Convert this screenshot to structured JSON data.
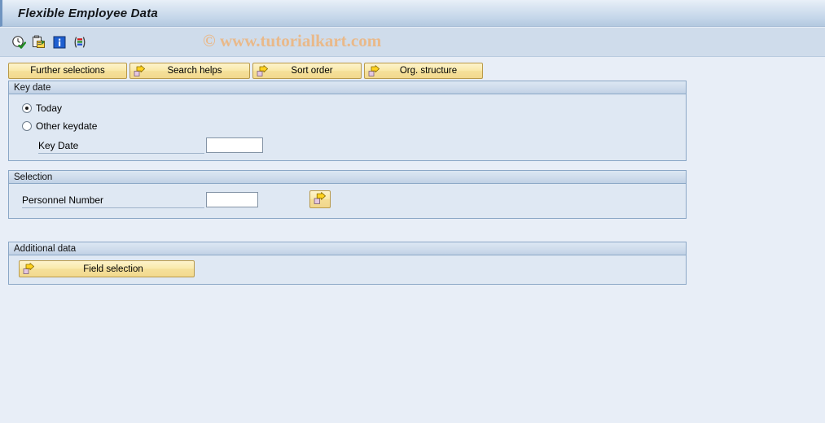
{
  "window": {
    "title": "Flexible Employee Data"
  },
  "toolbar": {
    "icons": [
      {
        "name": "execute-clock-icon",
        "title": "Execute"
      },
      {
        "name": "copy-variant-icon",
        "title": "Get Variant"
      },
      {
        "name": "info-icon",
        "title": "Information"
      },
      {
        "name": "stripes-selection-icon",
        "title": "Selection Options"
      }
    ]
  },
  "watermark": {
    "text": "© www.tutorialkart.com",
    "color": "#e9b98a"
  },
  "selection_buttons": [
    {
      "name": "further-selections-button",
      "label": "Further selections",
      "has_arrow_icon": false
    },
    {
      "name": "search-helps-button",
      "label": "Search helps",
      "has_arrow_icon": true
    },
    {
      "name": "sort-order-button",
      "label": "Sort order",
      "has_arrow_icon": true
    },
    {
      "name": "org-structure-button",
      "label": "Org. structure",
      "has_arrow_icon": true
    }
  ],
  "key_date_panel": {
    "header": "Key date",
    "radio_today": {
      "label": "Today",
      "checked": true
    },
    "radio_other": {
      "label": "Other keydate",
      "checked": false
    },
    "key_date_label": "Key Date",
    "key_date_value": "",
    "key_date_placeholder": ""
  },
  "selection_panel": {
    "header": "Selection",
    "personnel_number_label": "Personnel Number",
    "personnel_number_value": "",
    "personnel_number_placeholder": "",
    "multi_select_button": {
      "name": "personnel-number-multiple-selection-button",
      "title": "Multiple selection"
    }
  },
  "additional_data_panel": {
    "header": "Additional data",
    "field_selection_button": {
      "label": "Field selection"
    }
  },
  "colors": {
    "background": "#e8eef7",
    "titlebar_top": "#e9f0f8",
    "titlebar_bottom": "#b3c9e0",
    "toolbar": "#cfdceb",
    "panel_body": "#dfe8f3",
    "panel_border": "#8ba7c6",
    "button_yellow": "#f9e9ab",
    "button_border": "#b99a4a",
    "accent_arrow": "#ffcc00"
  }
}
